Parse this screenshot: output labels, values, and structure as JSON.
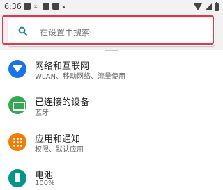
{
  "status_bar": {
    "time": "6:36"
  },
  "search": {
    "placeholder": "在设置中搜索"
  },
  "settings": [
    {
      "title": "网络和互联网",
      "subtitle": "WLAN、移动网络、流量使用",
      "icon": "wifi-icon"
    },
    {
      "title": "已连接的设备",
      "subtitle": "蓝牙",
      "icon": "connected-devices-icon"
    },
    {
      "title": "应用和通知",
      "subtitle": "权限、默认应用",
      "icon": "apps-grid-icon"
    },
    {
      "title": "电池",
      "subtitle": "100%",
      "icon": "battery-icon"
    }
  ],
  "colors": {
    "network": "#1a73e8",
    "devices": "#34a853",
    "apps": "#f57c00",
    "battery": "#009688",
    "highlight": "#e0374a"
  }
}
